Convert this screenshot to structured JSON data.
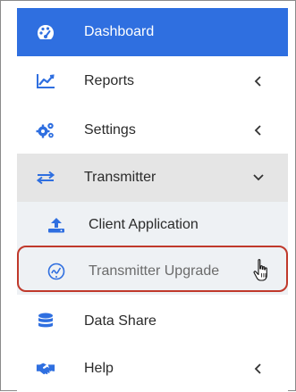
{
  "menu": {
    "items": [
      {
        "label": "Dashboard",
        "icon": "palette-gauge-icon"
      },
      {
        "label": "Reports",
        "icon": "chart-line-icon",
        "chevron": "left"
      },
      {
        "label": "Settings",
        "icon": "cogs-icon",
        "chevron": "left"
      },
      {
        "label": "Transmitter",
        "icon": "exchange-arrows-icon",
        "chevron": "down"
      },
      {
        "label": "Client Application",
        "icon": "upload-icon"
      },
      {
        "label": "Transmitter Upgrade",
        "icon": "upgrade-circle-icon"
      },
      {
        "label": "Data Share",
        "icon": "database-icon"
      },
      {
        "label": "Help",
        "icon": "handshake-icon",
        "chevron": "left"
      }
    ],
    "active_item": "Dashboard",
    "highlighted_item": "Transmitter Upgrade"
  },
  "colors": {
    "active_bg": "#2f6fe0",
    "icon_blue": "#2f6fe0",
    "highlight_border": "#c0392b",
    "expanded_bg": "#e5e5e5",
    "submenu_bg": "#eef1f4"
  }
}
